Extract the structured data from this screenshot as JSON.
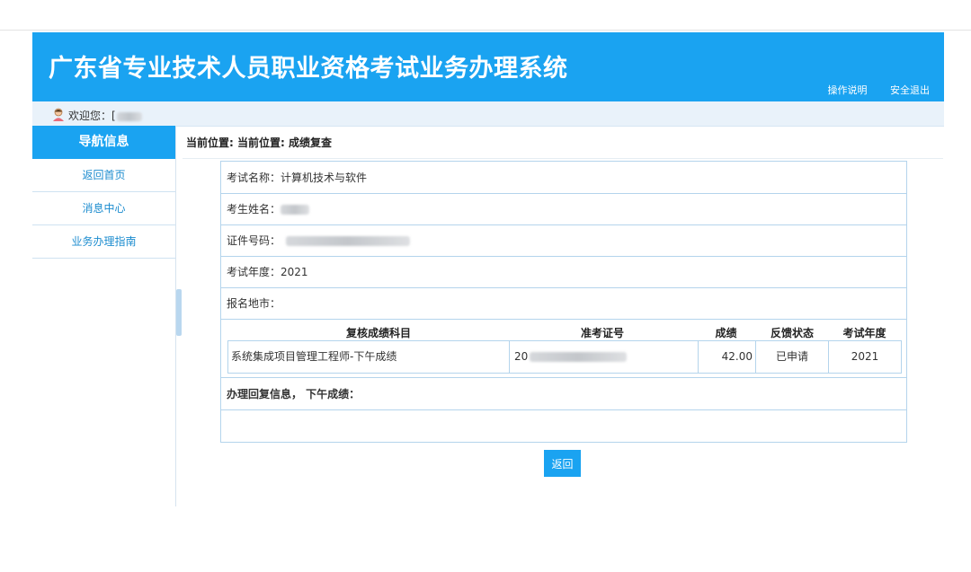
{
  "header": {
    "title": "广东省专业技术人员职业资格考试业务办理系统",
    "help_link": "操作说明",
    "logout_link": "安全退出"
  },
  "welcome": {
    "label": "欢迎您：["
  },
  "sidebar": {
    "title": "导航信息",
    "items": [
      {
        "label": "返回首页"
      },
      {
        "label": "消息中心"
      },
      {
        "label": "业务办理指南"
      }
    ]
  },
  "breadcrumb": "当前位置: 当前位置: 成绩复查",
  "details": {
    "exam_name": "考试名称：计算机技术与软件",
    "candidate_name": "考生姓名：",
    "id_number": "证件号码：",
    "exam_year": "考试年度：2021",
    "city": "报名地市："
  },
  "review_table": {
    "headers": [
      "复核成绩科目",
      "准考证号",
      "成绩",
      "反馈状态",
      "考试年度"
    ],
    "rows": [
      [
        "系统集成项目管理工程师-下午成绩",
        "20",
        "42.00",
        "已申请",
        "2021"
      ]
    ]
  },
  "reply_info": "办理回复信息， 下午成绩：",
  "buttons": {
    "back": "返回"
  },
  "colors": {
    "primary": "#1aa3f1",
    "border": "#b4d4ec",
    "nav_text": "#1c8ccf"
  }
}
